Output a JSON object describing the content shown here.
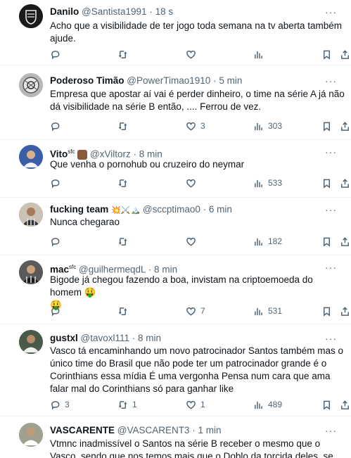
{
  "tweets": [
    {
      "name": "Danilo",
      "handle": "@Santista1991",
      "time": "· 18 s",
      "text": "Acho que a visibilidade de ter jogo toda semana na tv aberta  também ajude.",
      "replies": "",
      "retweets": "",
      "likes": "",
      "views": "",
      "avatar_color": "#1a1a1a"
    },
    {
      "name": "Poderoso Timão",
      "handle": "@PowerTimao1910",
      "time": "· 5 min",
      "text": "Empresa que apostar aí vai é perder dinheiro,  o time na série A já não dá visibilidade na série B então, .... Ferrou de vez.",
      "replies": "",
      "retweets": "",
      "likes": "3",
      "views": "303",
      "avatar_color": "#9a9a9a"
    },
    {
      "name": "Vito",
      "name_suffix": "sfc",
      "handle": "@xViltorz",
      "time": "· 8 min",
      "text": "Que venha o pornohub ou cruzeiro do neymar",
      "replies": "",
      "retweets": "",
      "likes": "",
      "views": "533",
      "avatar_color": "#2c4a8a"
    },
    {
      "name": "fucking team",
      "name_emojis": "💥⚔️🏔️",
      "handle": "@sccptimao0",
      "time": "· 6 min",
      "text": "Nunca chegarao",
      "replies": "",
      "retweets": "",
      "likes": "",
      "views": "182",
      "avatar_color": "#7a6a5a"
    },
    {
      "name": "mac",
      "name_suffix": "sfc",
      "handle": "@guilhermeqdL",
      "time": "· 8 min",
      "text": "Bigode já chegou fazendo a boa, invistam na criptoemoeda do homem 🤑",
      "text2": "🤑",
      "replies": "",
      "retweets": "",
      "likes": "7",
      "views": "531",
      "avatar_color": "#3a3a3a"
    },
    {
      "name": "gustxl",
      "handle": "@tavoxl111",
      "time": "· 8 min",
      "text": "Vasco tá encaminhando um novo patrocinador Santos também mas o único time do Brasil que não pode ter um patrocinador grande é o Corinthians essa mídia É uma vergonha Pensa num cara que ama falar mal do Corinthians só para ganhar like",
      "replies": "3",
      "retweets": "1",
      "likes": "1",
      "views": "489",
      "avatar_color": "#2e3a2e"
    },
    {
      "name": "VASCARENTE",
      "handle": "@VASCARENT3",
      "time": "· 1 min",
      "text": "Vtmnc inadmissível o Santos na série B receber o mesmo que o Vasco, sendo que nos temos mais que o Doblo da torcida deles. se isso acontecer",
      "replies": "",
      "retweets": "",
      "likes": "",
      "views": "",
      "avatar_color": "#8a8a7a"
    }
  ],
  "more_label": "···"
}
